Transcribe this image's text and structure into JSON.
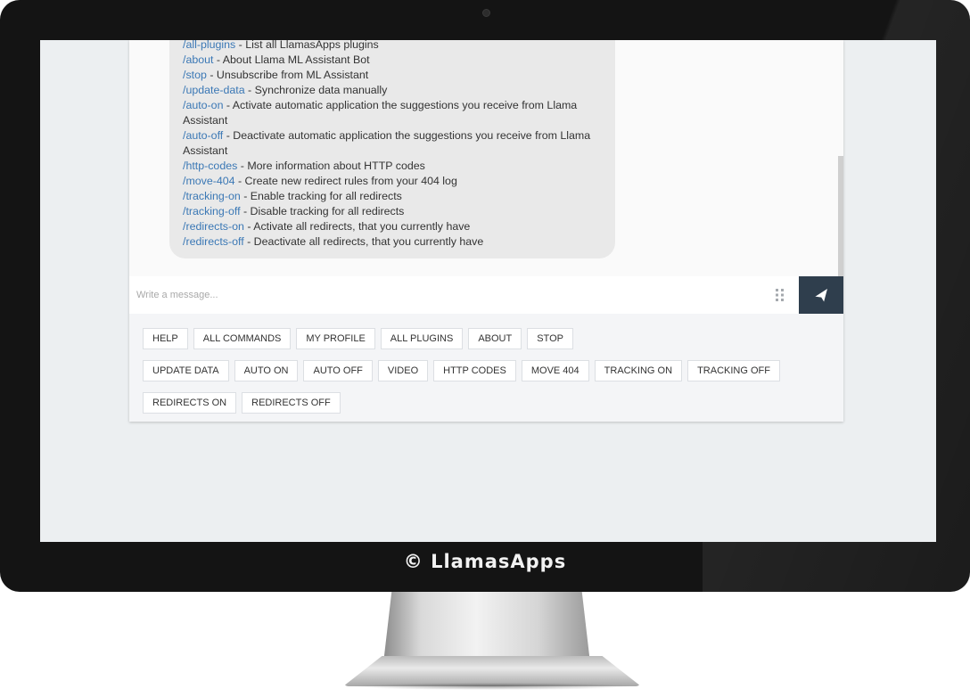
{
  "screen_brand": "© LlamasApps",
  "chat": {
    "commands": [
      {
        "cmd": "/all-plugins",
        "desc": " - List all LlamasApps plugins"
      },
      {
        "cmd": "/about",
        "desc": " - About Llama ML Assistant Bot"
      },
      {
        "cmd": "/stop",
        "desc": " - Unsubscribe from ML Assistant"
      },
      {
        "cmd": "/update-data",
        "desc": " - Synchronize data manually"
      },
      {
        "cmd": "/auto-on",
        "desc": " - Activate automatic application the suggestions you receive from Llama Assistant"
      },
      {
        "cmd": "/auto-off",
        "desc": " - Deactivate automatic application the suggestions you receive from Llama Assistant"
      },
      {
        "cmd": "/http-codes",
        "desc": " - More information about HTTP codes"
      },
      {
        "cmd": "/move-404",
        "desc": " - Create new redirect rules from your 404 log"
      },
      {
        "cmd": "/tracking-on",
        "desc": " - Enable tracking for all redirects"
      },
      {
        "cmd": "/tracking-off",
        "desc": " - Disable tracking for all redirects"
      },
      {
        "cmd": "/redirects-on",
        "desc": " - Activate all redirects, that you currently have"
      },
      {
        "cmd": "/redirects-off",
        "desc": " - Deactivate all redirects, that you currently have"
      }
    ],
    "input": {
      "placeholder": "Write a message...",
      "value": ""
    },
    "quick_replies": [
      [
        "HELP",
        "ALL COMMANDS",
        "MY PROFILE",
        "ALL PLUGINS",
        "ABOUT",
        "STOP"
      ],
      [
        "UPDATE DATA",
        "AUTO ON",
        "AUTO OFF",
        "VIDEO",
        "HTTP CODES",
        "MOVE 404",
        "TRACKING ON",
        "TRACKING OFF"
      ],
      [
        "REDIRECTS ON",
        "REDIRECTS OFF"
      ]
    ]
  },
  "icons": {
    "grid": "grid-dots-icon",
    "send": "paper-plane-icon"
  },
  "colors": {
    "link": "#3b78b5",
    "send_button": "#2f3e4d",
    "bubble": "#e9e9e9"
  }
}
